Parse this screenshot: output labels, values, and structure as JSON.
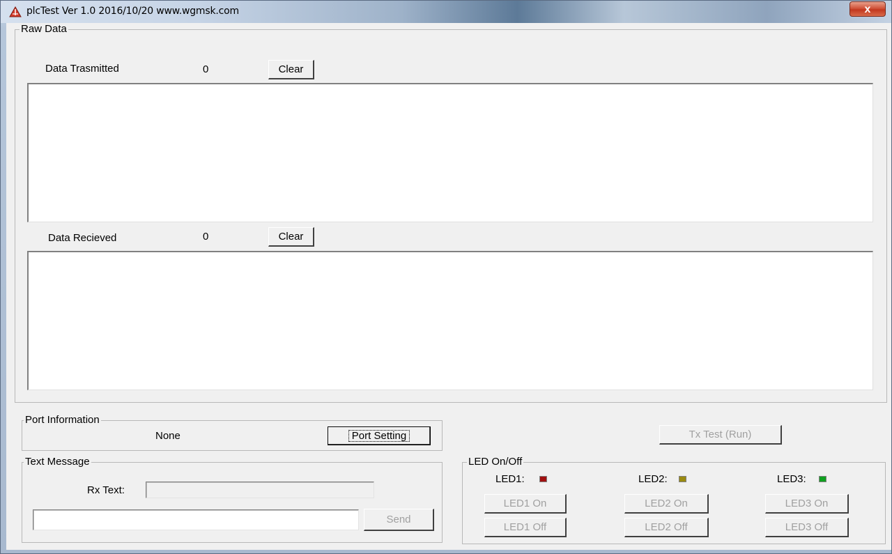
{
  "window": {
    "title": "plcTest Ver 1.0 2016/10/20   www.wgmsk.com",
    "close_label": "x"
  },
  "raw_data": {
    "group_title": "Raw Data",
    "transmitted_label": "Data Trasmitted",
    "transmitted_count": "0",
    "transmitted_clear": "Clear",
    "received_label": "Data Recieved",
    "received_count": "0",
    "received_clear": "Clear"
  },
  "port": {
    "group_title": "Port Information",
    "status": "None",
    "setting_button": "Port Setting"
  },
  "tx_test_button": "Tx Test (Run)",
  "text_message": {
    "group_title": "Text Message",
    "rx_label": "Rx Text:",
    "rx_value": "",
    "send_value": "",
    "send_button": "Send"
  },
  "led": {
    "group_title": "LED On/Off",
    "items": [
      {
        "label": "LED1:",
        "color": "#a01010",
        "on": "LED1 On",
        "off": "LED1 Off"
      },
      {
        "label": "LED2:",
        "color": "#9a8a10",
        "on": "LED2 On",
        "off": "LED2 Off"
      },
      {
        "label": "LED3:",
        "color": "#10a020",
        "on": "LED3 On",
        "off": "LED3 Off"
      }
    ]
  }
}
